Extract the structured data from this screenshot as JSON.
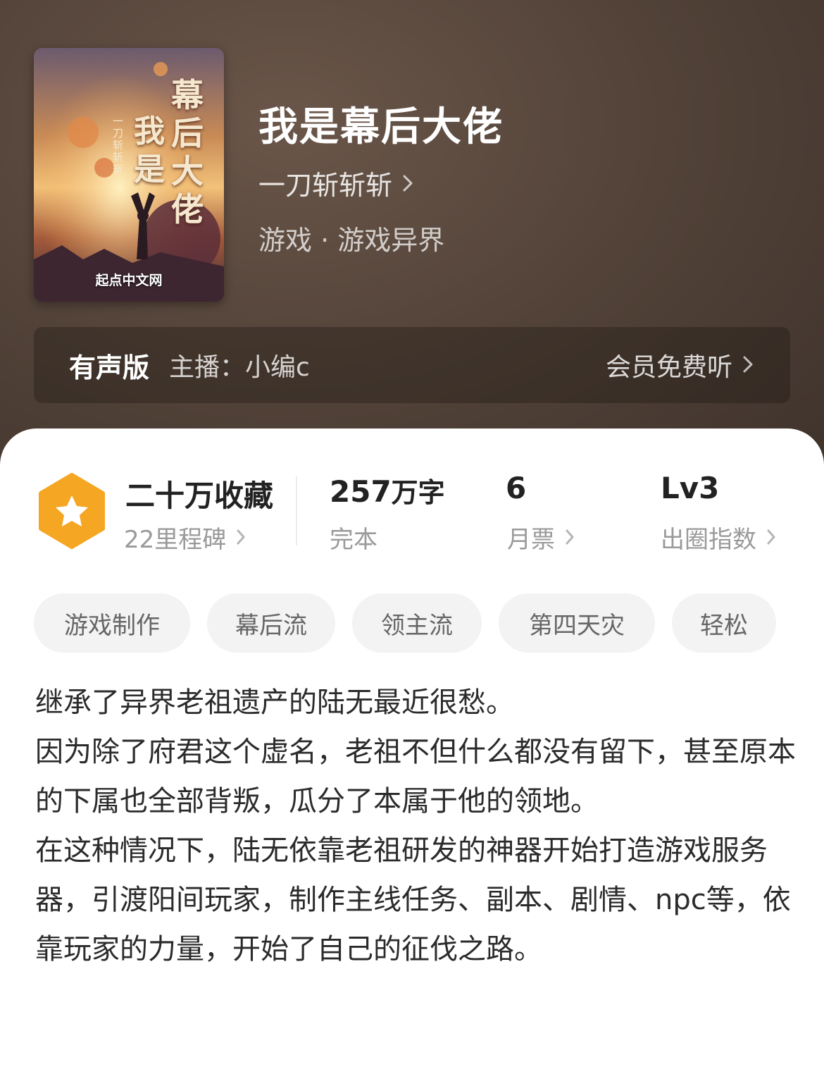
{
  "book": {
    "title": "我是幕后大佬",
    "author": "一刀斩斩斩",
    "genre": "游戏 · 游戏异界",
    "cover": {
      "title_chars": [
        "幕",
        "后",
        "大",
        "佬"
      ],
      "title_chars_left": [
        "我",
        "是"
      ],
      "author_vertical": "一刀斩斩斩",
      "publisher": "起点中文网"
    }
  },
  "audio": {
    "label": "有声版",
    "host": "主播：小编c",
    "cta": "会员免费听"
  },
  "stats": {
    "favorites": "二十万收藏",
    "milestones": "22里程碑",
    "word_count_number": "257",
    "word_count_unit": "万字",
    "status": "完本",
    "monthly_votes": "6",
    "monthly_votes_label": "月票",
    "level": "Lv3",
    "level_label": "出圈指数"
  },
  "tags": [
    "游戏制作",
    "幕后流",
    "领主流",
    "第四天灾",
    "轻松"
  ],
  "description": [
    "继承了异界老祖遗产的陆无最近很愁。",
    "因为除了府君这个虚名，老祖不但什么都没有留下，甚至原本的下属也全部背叛，瓜分了本属于他的领地。",
    "在这种情况下，陆无依靠老祖研发的神器开始打造游戏服务器，引渡阳间玩家，制作主线任务、副本、剧情、npc等，依靠玩家的力量，开始了自己的征伐之路。"
  ],
  "colors": {
    "hero_bg": "#54443a",
    "badge_orange": "#f5a623",
    "tag_bg": "#f3f3f3"
  }
}
